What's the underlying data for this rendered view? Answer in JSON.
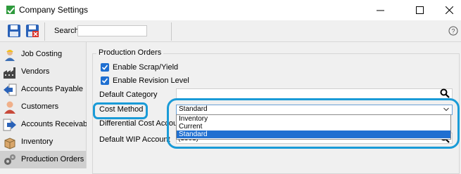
{
  "window": {
    "title": "Company Settings"
  },
  "toolbar": {
    "search_label": "Search",
    "search_value": ""
  },
  "sidebar": {
    "items": [
      {
        "label": "Job Costing",
        "icon": "worker-icon"
      },
      {
        "label": "Vendors",
        "icon": "factory-icon"
      },
      {
        "label": "Accounts Payable",
        "icon": "arrow-left-icon"
      },
      {
        "label": "Customers",
        "icon": "person-icon"
      },
      {
        "label": "Accounts Receivable",
        "icon": "arrow-right-icon"
      },
      {
        "label": "Inventory",
        "icon": "box-icon"
      },
      {
        "label": "Production Orders",
        "icon": "gears-icon"
      }
    ],
    "selected": "Production Orders"
  },
  "main": {
    "group_title": "Production Orders",
    "enable_scrap": {
      "label": "Enable Scrap/Yield",
      "checked": true
    },
    "enable_revision": {
      "label": "Enable Revision Level",
      "checked": true
    },
    "default_category_label": "Default Category",
    "cost_method_label": "Cost Method",
    "cost_method_value": "Standard",
    "cost_method_options": [
      "Inventory",
      "Current",
      "Standard"
    ],
    "differential_label": "Differential Cost Account",
    "default_wip_label": "Default WIP Account",
    "default_wip_value": "(1301)"
  },
  "colors": {
    "accent": "#1a9bd7",
    "selection": "#1f6fd1"
  }
}
